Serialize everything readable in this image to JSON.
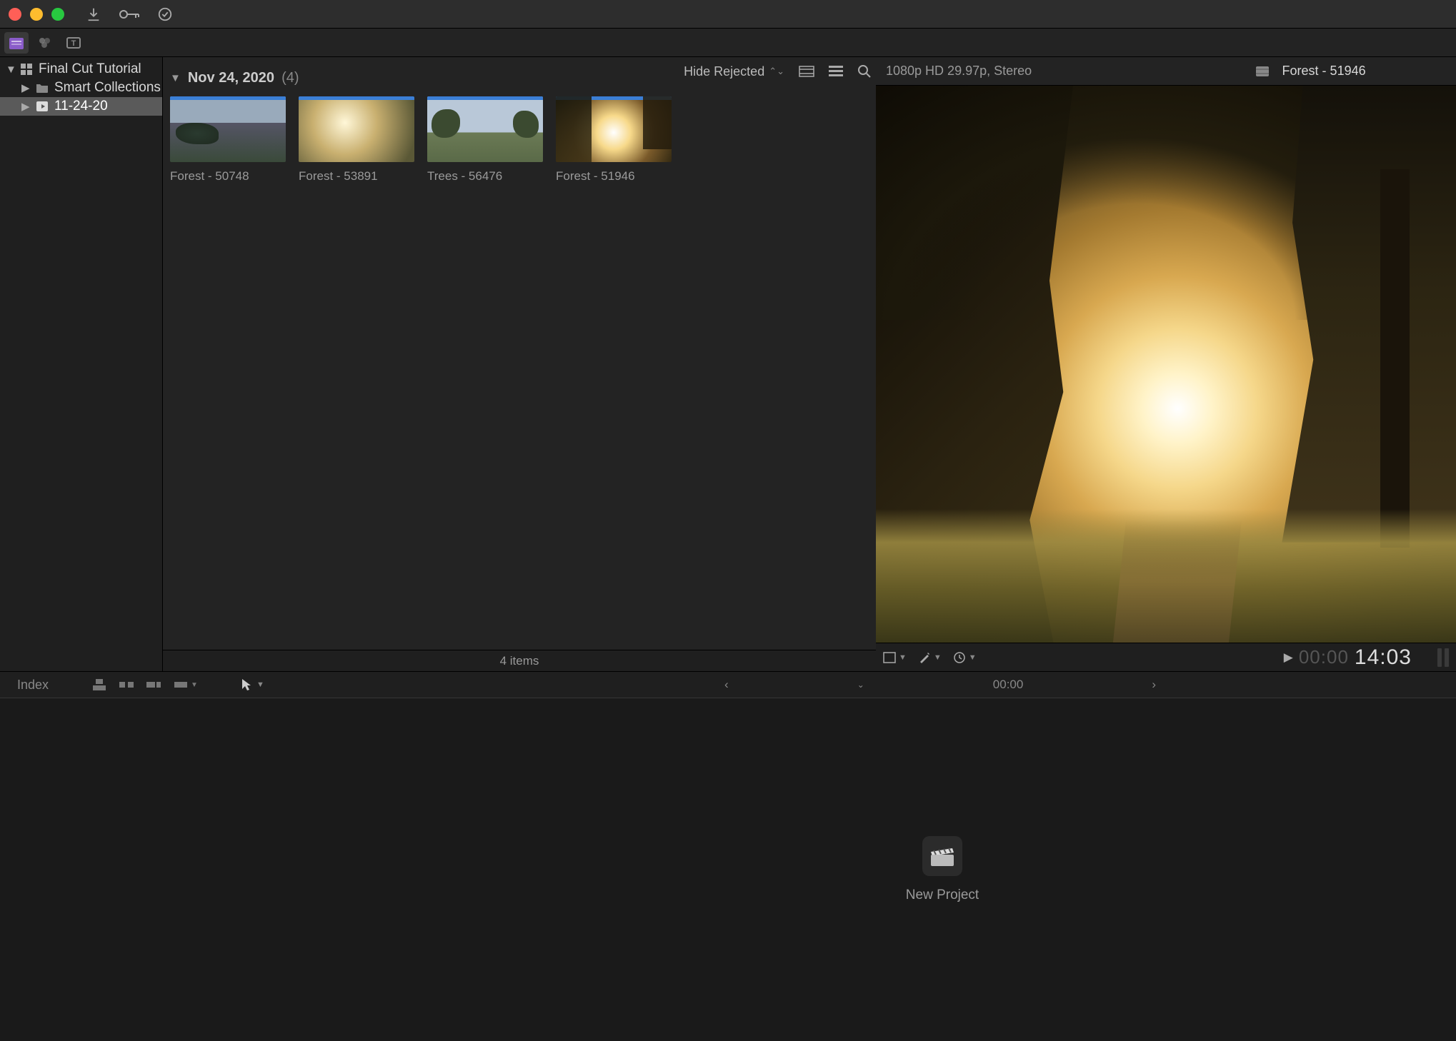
{
  "titlebar": {
    "close": "#ff5f57",
    "min": "#febc2e",
    "max": "#28c840"
  },
  "sidebar": {
    "library_name": "Final Cut Tutorial",
    "smart": "Smart Collections",
    "event": "11-24-20"
  },
  "browser": {
    "hide_rejected": "Hide Rejected",
    "group_date": "Nov 24, 2020",
    "group_count": "(4)",
    "clips": [
      {
        "label": "Forest - 50748"
      },
      {
        "label": "Forest - 53891"
      },
      {
        "label": "Trees - 56476"
      },
      {
        "label": "Forest - 51946"
      }
    ],
    "footer": "4 items"
  },
  "viewer": {
    "format": "1080p HD 29.97p, Stereo",
    "title": "Forest - 51946",
    "timecode_prefix": "00:00",
    "timecode": "14:03"
  },
  "timeline": {
    "index": "Index",
    "zoom_time": "00:00",
    "new_project": "New Project"
  }
}
